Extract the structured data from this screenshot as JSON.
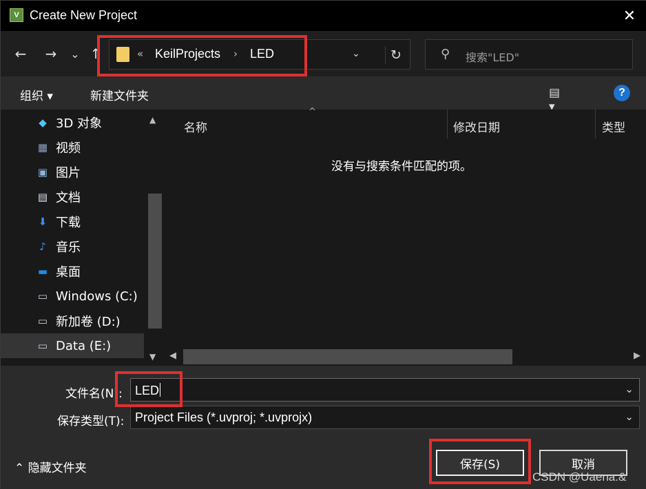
{
  "window": {
    "app_icon_text": "V",
    "title": "Create New Project",
    "close_glyph": "✕"
  },
  "nav": {
    "back": "←",
    "forward": "→",
    "recent": "⌄",
    "up": "↑",
    "address": {
      "overflow": "«",
      "segments": [
        "KeilProjects",
        "LED"
      ],
      "separator": "›",
      "dropdown": "⌄",
      "refresh": "↻"
    },
    "search": {
      "icon": "⚲",
      "placeholder": "搜索\"LED\""
    }
  },
  "toolbar": {
    "organize": "组织 ▾",
    "new_folder": "新建文件夹",
    "view": "▤ ▾",
    "help": "?"
  },
  "sidebar": {
    "items": [
      {
        "label": "3D 对象",
        "icon": "cube-icon",
        "glyph": "◆",
        "color": "#4fc3f7"
      },
      {
        "label": "视频",
        "icon": "video-icon",
        "glyph": "▦",
        "color": "#8fa3c7"
      },
      {
        "label": "图片",
        "icon": "picture-icon",
        "glyph": "▣",
        "color": "#8fb3d9"
      },
      {
        "label": "文档",
        "icon": "document-icon",
        "glyph": "▤",
        "color": "#dfe6ee"
      },
      {
        "label": "下载",
        "icon": "download-icon",
        "glyph": "⬇",
        "color": "#3d8ef0"
      },
      {
        "label": "音乐",
        "icon": "music-icon",
        "glyph": "♪",
        "color": "#3d8ef0"
      },
      {
        "label": "桌面",
        "icon": "desktop-icon",
        "glyph": "▬",
        "color": "#1e88e5"
      },
      {
        "label": "Windows (C:)",
        "icon": "drive-c-icon",
        "glyph": "▭",
        "color": "#c9d3de"
      },
      {
        "label": "新加卷 (D:)",
        "icon": "drive-d-icon",
        "glyph": "▭",
        "color": "#c9d3de"
      },
      {
        "label": "Data (E:)",
        "icon": "drive-e-icon",
        "glyph": "▭",
        "color": "#c9d3de"
      }
    ],
    "selected_index": 9,
    "scroll_up": "▲",
    "scroll_down": "▼"
  },
  "filelist": {
    "columns": [
      "名称",
      "修改日期",
      "类型"
    ],
    "sort_indicator": "^",
    "empty_message": "没有与搜索条件匹配的项。",
    "scroll_left": "◀",
    "scroll_right": "▶"
  },
  "form": {
    "filename_label": "文件名(N):",
    "filename_value": "LED",
    "filetype_label": "保存类型(T):",
    "filetype_value": "Project Files (*.uvproj; *.uvprojx)",
    "dropdown": "⌄"
  },
  "footer": {
    "hide_folders": "⌃  隐藏文件夹",
    "save": "保存(S)",
    "cancel": "取消",
    "watermark": "CSDN @Uaena.&"
  },
  "colors": {
    "annotation_red": "#e03030",
    "folder_yellow": "#f2cd63",
    "help_blue": "#1e72d0"
  }
}
